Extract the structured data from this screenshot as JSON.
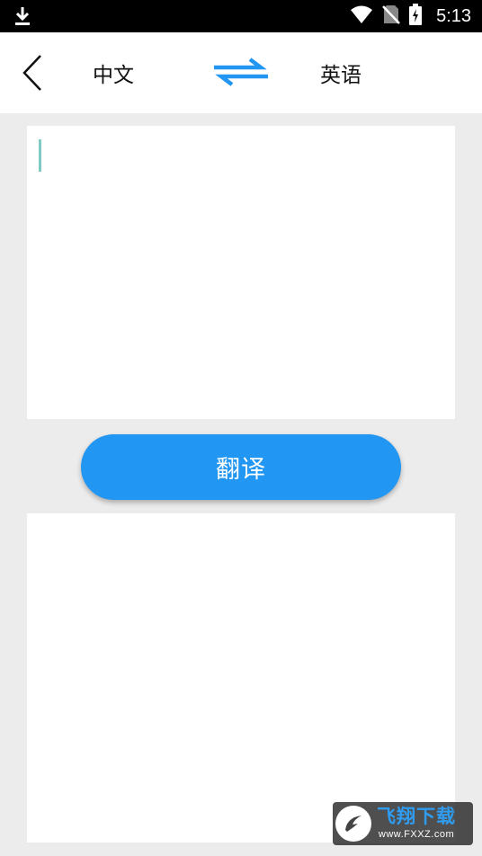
{
  "status_bar": {
    "time": "5:13",
    "icons": [
      "download-icon",
      "wifi-icon",
      "no-sim-icon",
      "battery-charging-icon"
    ]
  },
  "header": {
    "back_icon": "chevron-left-icon",
    "source_language": "中文",
    "target_language": "英语",
    "swap_icon": "swap-arrows-icon"
  },
  "input": {
    "value": ""
  },
  "translate_button": {
    "label": "翻译"
  },
  "output": {
    "value": ""
  },
  "watermark": {
    "text": "飞翔下载",
    "url": "www.FXXZ.com"
  },
  "colors": {
    "accent": "#2196f3",
    "background": "#ececec",
    "caret": "#7fcac4",
    "status_bar": "#000000"
  }
}
